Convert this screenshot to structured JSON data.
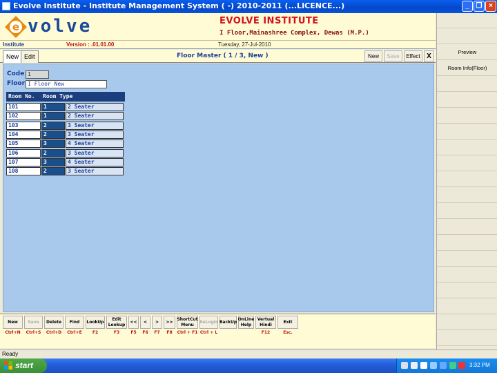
{
  "window": {
    "title": "Evolve Institute - Institute Management System ( -) 2010-2011 (...LICENCE...)"
  },
  "header": {
    "logo_text": "volve",
    "institute_name": "EVOLVE INSTITUTE",
    "address": "I Floor,Mainashree Complex, Dewas (M.P.)"
  },
  "info": {
    "module": "Institute",
    "version": "Version : .01.01.00",
    "date": "Tuesday, 27-Jul-2010"
  },
  "tabs": [
    {
      "label": "New",
      "active": true
    },
    {
      "label": "Edit",
      "active": false
    }
  ],
  "form": {
    "title": "Floor Master  ( 1 / 3, New )",
    "code_label": "Code",
    "code_value": "1",
    "floor_label": "Floor",
    "floor_value": "I Floor New"
  },
  "top_buttons": {
    "new": "New",
    "save": "Save",
    "effect": "Effect",
    "close": "X"
  },
  "grid": {
    "headers": [
      "Room No.",
      "Room Type"
    ],
    "rows": [
      {
        "room": "101",
        "type": "1",
        "desc": "2 Seater"
      },
      {
        "room": "102",
        "type": "1",
        "desc": "2 Seater"
      },
      {
        "room": "103",
        "type": "2",
        "desc": "3 Seater"
      },
      {
        "room": "104",
        "type": "2",
        "desc": "3 Seater"
      },
      {
        "room": "105",
        "type": "3",
        "desc": "4 Seater"
      },
      {
        "room": "106",
        "type": "2",
        "desc": "3 Seater"
      },
      {
        "room": "107",
        "type": "3",
        "desc": "4 Seater"
      },
      {
        "room": "108",
        "type": "2",
        "desc": "3 Seater"
      }
    ]
  },
  "bottom_buttons": [
    {
      "label": "New",
      "key": "Ctrl+N",
      "enabled": true
    },
    {
      "label": "Save",
      "key": "Ctrl+S",
      "enabled": false
    },
    {
      "label": "Delete",
      "key": "Ctrl+D",
      "enabled": true
    },
    {
      "label": "Find",
      "key": "Ctrl+E",
      "enabled": true
    },
    {
      "label": "LookUp",
      "key": "F2",
      "enabled": true
    },
    {
      "label": "Edit Lookup",
      "key": "F3",
      "enabled": true
    },
    {
      "label": "<<",
      "key": "F5",
      "enabled": true
    },
    {
      "label": "<",
      "key": "F6",
      "enabled": true
    },
    {
      "label": ">",
      "key": "F7",
      "enabled": true
    },
    {
      "label": ">>",
      "key": "F8",
      "enabled": true
    },
    {
      "label": "ShortCut Menu",
      "key": "Ctrl + F1",
      "enabled": true
    },
    {
      "label": "ReLogin",
      "key": "Ctrl + L",
      "enabled": false
    },
    {
      "label": "BackUp",
      "key": "",
      "enabled": true
    },
    {
      "label": "OnLine Help",
      "key": "",
      "enabled": true
    },
    {
      "label": "Vertual Hindi",
      "key": "F12",
      "enabled": true
    },
    {
      "label": "Exit",
      "key": "Esc.",
      "enabled": true
    }
  ],
  "side_panel": {
    "preview": "Preview",
    "room_info": "Room Info(Floor)"
  },
  "status": {
    "text": "Ready"
  },
  "taskbar": {
    "start": "start",
    "clock": "3:32 PM"
  },
  "colors": {
    "title_blue": "#0448c8",
    "header_bg": "#fffbd4",
    "form_bg": "#a8c8ec",
    "accent_red": "#d5101a",
    "grid_head": "#1b3e7c"
  }
}
